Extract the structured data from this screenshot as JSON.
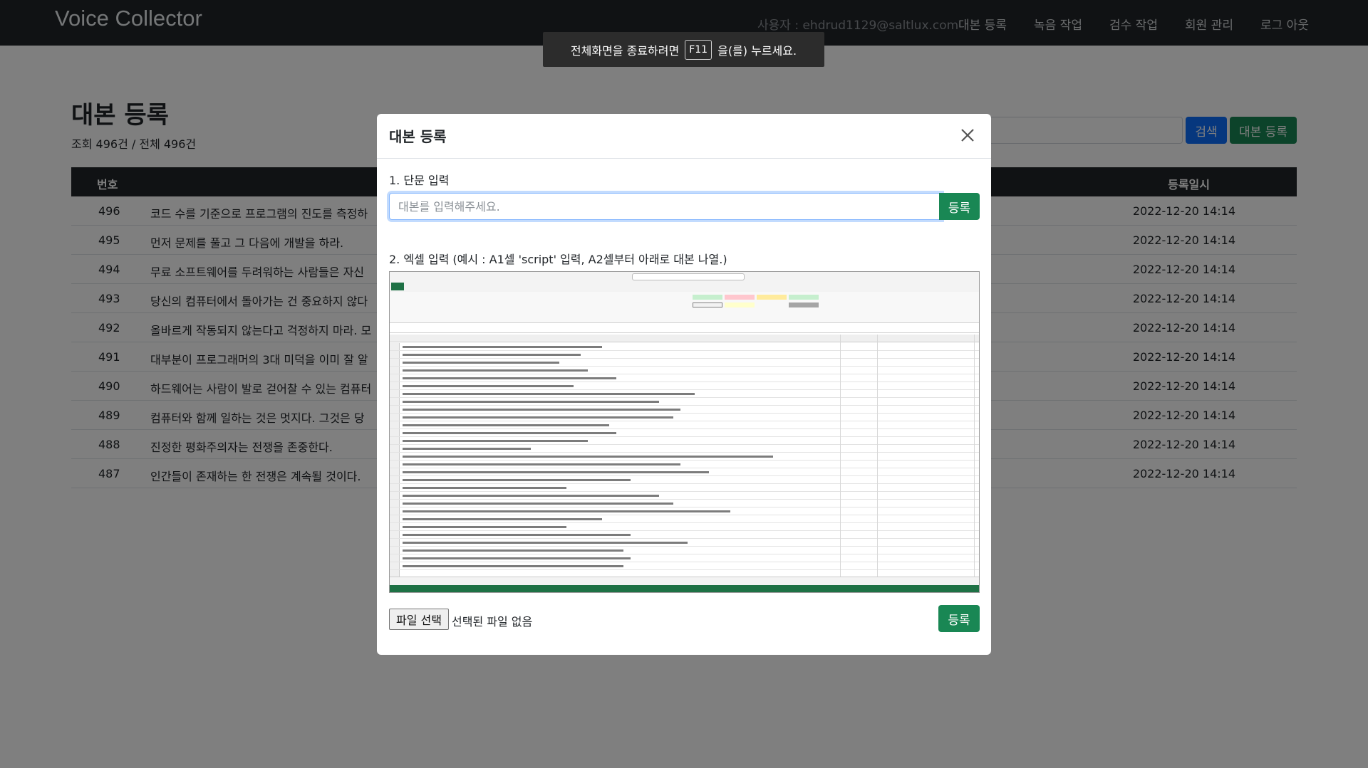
{
  "navbar": {
    "brand": "Voice Collector",
    "user": "사용자 : ehdrud1129@saltlux.com",
    "links": [
      "대본 등록",
      "녹음 작업",
      "검수 작업",
      "회원 관리",
      "로그 아웃"
    ]
  },
  "page": {
    "title": "대본 등록",
    "count": "조회 496건 / 전체 496건",
    "search_button": "검색",
    "register_button": "대본 등록"
  },
  "table": {
    "headers": {
      "number": "번호",
      "date": "등록일시"
    },
    "rows": [
      {
        "num": "496",
        "text": "코드 수를 기준으로 프로그램의 진도를 측정하",
        "date": "2022-12-20 14:14"
      },
      {
        "num": "495",
        "text": "먼저 문제를 풀고 그 다음에 개발을 하라.",
        "date": "2022-12-20 14:14"
      },
      {
        "num": "494",
        "text": "무료 소프트웨어를 두려워하는 사람들은 자신",
        "date": "2022-12-20 14:14"
      },
      {
        "num": "493",
        "text": "당신의 컴퓨터에서 돌아가는 건 중요하지 않다",
        "date": "2022-12-20 14:14"
      },
      {
        "num": "492",
        "text": "올바르게 작동되지 않는다고 걱정하지 마라. 모",
        "date": "2022-12-20 14:14"
      },
      {
        "num": "491",
        "text": "대부분이 프로그래머의 3대 미덕을 이미 잘 알",
        "date": "2022-12-20 14:14"
      },
      {
        "num": "490",
        "text": "하드웨어는 사람이 발로 걷어찰 수 있는 컴퓨터",
        "date": "2022-12-20 14:14"
      },
      {
        "num": "489",
        "text": "컴퓨터와 함께 일하는 것은 멋지다. 그것은 당",
        "date": "2022-12-20 14:14"
      },
      {
        "num": "488",
        "text": "진정한 평화주의자는 전쟁을 존중한다.",
        "date": "2022-12-20 14:14"
      },
      {
        "num": "487",
        "text": "인간들이 존재하는 한 전쟁은 계속될 것이다.",
        "date": "2022-12-20 14:14"
      }
    ]
  },
  "fullscreen_notice": {
    "before": "전체화면을 종료하려면",
    "key": "F11",
    "after": "을(를) 누르세요."
  },
  "modal": {
    "title": "대본 등록",
    "close_icon": "close-icon",
    "section1_label": "1. 단문 입력",
    "input_placeholder": "대본를 입력해주세요.",
    "input_value": "",
    "register_label": "등록",
    "section2_label": "2. 엑셀 입력 (예시 : A1셀 'script' 입력, A2셀부터 아래로 대본 나열.)",
    "file_button": "파일 선택",
    "file_status": "선택된 파일 없음",
    "file_register_label": "등록"
  },
  "colors": {
    "navbar": "#212529",
    "primary": "#0d6efd",
    "success": "#198754",
    "excel_green": "#1e7145"
  }
}
